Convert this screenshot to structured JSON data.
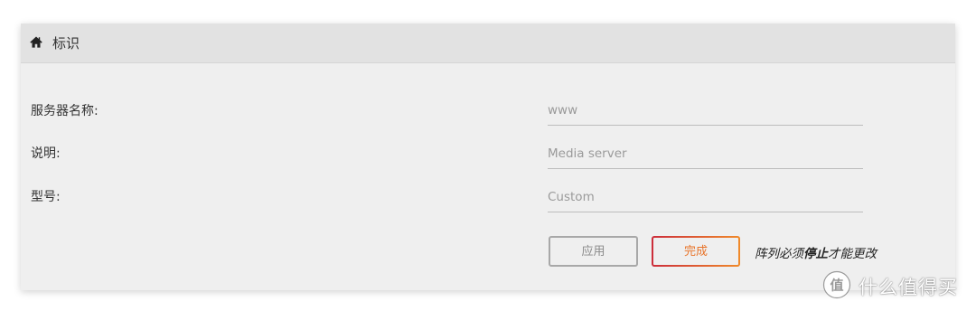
{
  "header": {
    "icon": "home-icon",
    "title": "标识"
  },
  "form": {
    "server_name": {
      "label": "服务器名称:",
      "placeholder": "www"
    },
    "description": {
      "label": "说明:",
      "placeholder": "Media server"
    },
    "model": {
      "label": "型号:",
      "placeholder": "Custom"
    }
  },
  "actions": {
    "apply_label": "应用",
    "done_label": "完成",
    "note_prefix": "阵列必须",
    "note_strong": "停止",
    "note_suffix": "才能更改"
  },
  "watermark": {
    "logo_icon": "zhi-logo-icon",
    "text": "什么值得买"
  },
  "colors": {
    "panel_bg": "#efefef",
    "header_bg": "#e2e2e2",
    "done_gradient_start": "#cc2d3b",
    "done_gradient_end": "#f08a2a",
    "done_text": "#e8742a"
  }
}
